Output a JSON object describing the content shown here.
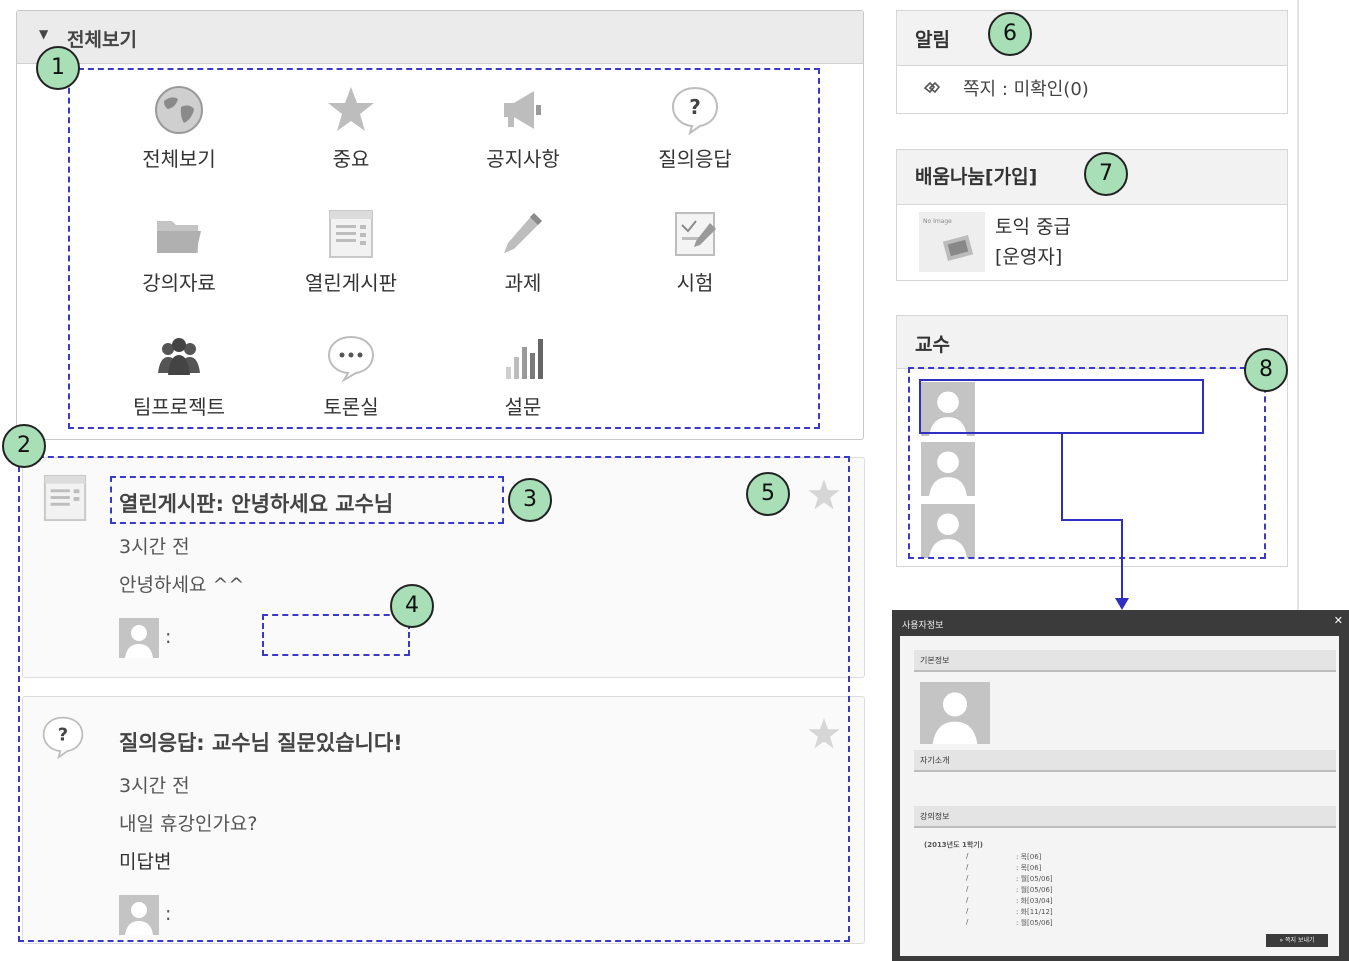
{
  "all_panel": {
    "title": "전체보기",
    "menu": [
      {
        "label": "전체보기",
        "icon": "globe-icon"
      },
      {
        "label": "중요",
        "icon": "star-icon"
      },
      {
        "label": "공지사항",
        "icon": "megaphone-icon"
      },
      {
        "label": "질의응답",
        "icon": "question-bubble-icon"
      },
      {
        "label": "강의자료",
        "icon": "folder-icon"
      },
      {
        "label": "열린게시판",
        "icon": "board-icon"
      },
      {
        "label": "과제",
        "icon": "pencil-icon"
      },
      {
        "label": "시험",
        "icon": "exam-icon"
      },
      {
        "label": "팀프로젝트",
        "icon": "team-icon"
      },
      {
        "label": "토론실",
        "icon": "chat-bubble-icon"
      },
      {
        "label": "설문",
        "icon": "bar-chart-icon"
      }
    ]
  },
  "feed": [
    {
      "title": "열린게시판: 안녕하세요 교수님",
      "time": "3시간 전",
      "body": "안녕하세요 ^^",
      "author_sep": ":",
      "icon": "board-icon"
    },
    {
      "title": "질의응답: 교수님 질문있습니다!",
      "time": "3시간 전",
      "body": "내일 휴강인가요?",
      "status": "미답변",
      "author_sep": ":",
      "icon": "question-bubble-icon"
    }
  ],
  "notice": {
    "title": "알림",
    "item": "쪽지 : 미확인(0)"
  },
  "learning": {
    "title": "배움나눔[가입]",
    "thumb_text": "No Image",
    "name": "토익 중급",
    "role": "[운영자]"
  },
  "professor": {
    "title": "교수"
  },
  "badges": [
    "1",
    "2",
    "3",
    "4",
    "5",
    "6",
    "7",
    "8"
  ],
  "popup": {
    "title": "사용자정보",
    "close": "✕",
    "basic": "기본정보",
    "intro": "자기소개",
    "lecture": "강의정보",
    "term": "(2013년도 1학기)",
    "rows": [
      {
        "a": "/",
        "b": ": 목[06]"
      },
      {
        "a": "/",
        "b": ": 목[06]"
      },
      {
        "a": "/",
        "b": ": 월[05/06]"
      },
      {
        "a": "/",
        "b": ": 월[05/06]"
      },
      {
        "a": "/",
        "b": ": 화[03/04]"
      },
      {
        "a": "/",
        "b": ": 화[11/12]"
      },
      {
        "a": "/",
        "b": ": 월[05/06]"
      }
    ],
    "button": "» 쪽지 보내기"
  },
  "colors": {
    "annotation": "#3a3ac8",
    "badge": "#a8dfb6",
    "icon_gray": "#bdbdbd"
  }
}
